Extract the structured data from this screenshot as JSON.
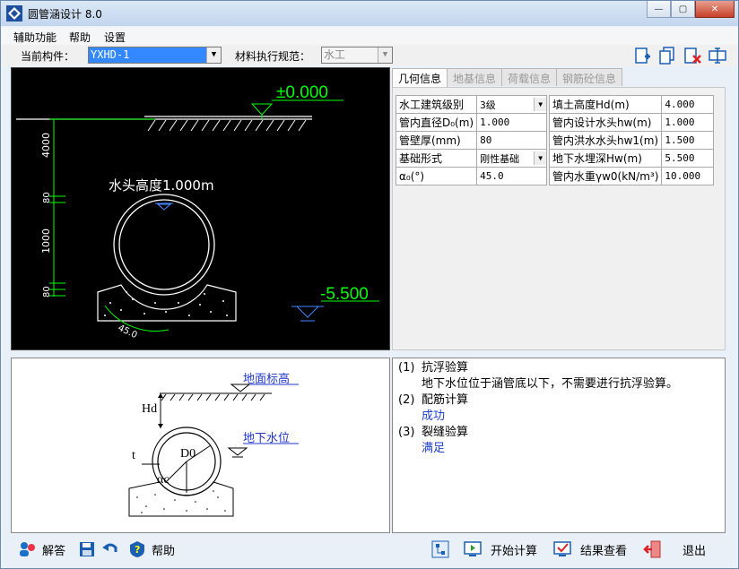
{
  "window": {
    "title": "圆管涵设计 8.0"
  },
  "menu": [
    "辅助功能",
    "帮助",
    "设置"
  ],
  "component": {
    "label": "当前构件：",
    "value": "YXHD-1",
    "spec_label": "材料执行规范：",
    "spec_value": "水工"
  },
  "tabs": [
    "几何信息",
    "地基信息",
    "荷载信息",
    "钢筋砼信息"
  ],
  "geometry_left": [
    {
      "k": "水工建筑级别",
      "v": "3级",
      "select": true
    },
    {
      "k": "管内直径D₀(m)",
      "v": "1.000"
    },
    {
      "k": "管壁厚(mm)",
      "v": "80"
    },
    {
      "k": "基础形式",
      "v": "刚性基础",
      "select": true
    },
    {
      "k": "α₀(°)",
      "v": "45.0"
    }
  ],
  "geometry_right": [
    {
      "k": "填土高度Hd(m)",
      "v": "4.000"
    },
    {
      "k": "管内设计水头hw(m)",
      "v": "1.000"
    },
    {
      "k": "管内洪水水头hw1(m)",
      "v": "1.500"
    },
    {
      "k": "地下水埋深Hw(m)",
      "v": "5.500"
    },
    {
      "k": "管内水重γw0(kN/m³)",
      "v": "10.000"
    }
  ],
  "cad": {
    "top_elev": "±0.000",
    "bottom_elev": "-5.500",
    "water_head": "水头高度1.000m",
    "dim_4000": "4000",
    "dim_80a": "80",
    "dim_1000": "1000",
    "dim_80b": "80",
    "angle": "45.0"
  },
  "diagram": {
    "ground": "地面标高",
    "groundwater": "地下水位",
    "hd": "Hd",
    "t": "t",
    "d0": "D0",
    "alpha": "αc"
  },
  "results": [
    {
      "n": "(1)",
      "title": "抗浮验算",
      "detail": "地下水位位于涵管底以下，不需要进行抗浮验算。",
      "blue": false
    },
    {
      "n": "(2)",
      "title": "配筋计算",
      "detail": "成功",
      "blue": true
    },
    {
      "n": "(3)",
      "title": "裂缝验算",
      "detail": "满足",
      "blue": true
    }
  ],
  "bottom": {
    "answer": "解答",
    "help": "帮助",
    "start": "开始计算",
    "view": "结果查看",
    "exit": "退出"
  }
}
